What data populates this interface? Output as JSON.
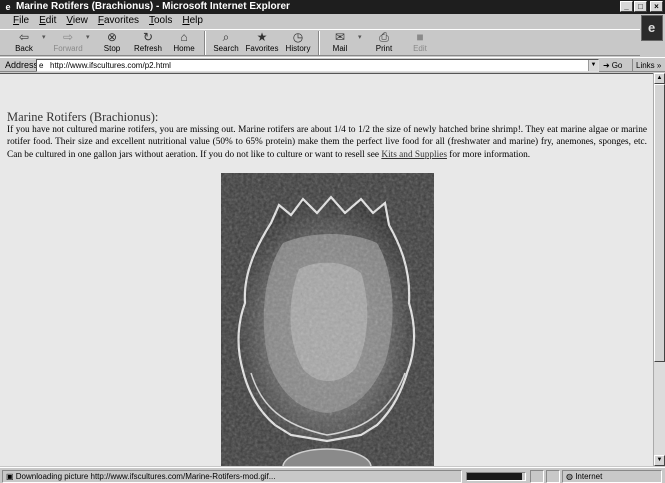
{
  "window": {
    "title": "Marine Rotifers (Brachionus) - Microsoft Internet Explorer",
    "minimize": "_",
    "maximize": "□",
    "close": "×"
  },
  "menu": [
    "File",
    "Edit",
    "View",
    "Favorites",
    "Tools",
    "Help"
  ],
  "toolbar": [
    {
      "label": "Back",
      "icon": "back-arrow-icon",
      "glyph": "⇦",
      "enabled": true
    },
    {
      "label": "Forward",
      "icon": "forward-arrow-icon",
      "glyph": "⇨",
      "enabled": false
    },
    {
      "label": "Stop",
      "icon": "stop-icon",
      "glyph": "⊗",
      "enabled": true
    },
    {
      "label": "Refresh",
      "icon": "refresh-icon",
      "glyph": "↻",
      "enabled": true
    },
    {
      "label": "Home",
      "icon": "home-icon",
      "glyph": "⌂",
      "enabled": true
    },
    {
      "label": "Search",
      "icon": "search-icon",
      "glyph": "⌕",
      "enabled": true
    },
    {
      "label": "Favorites",
      "icon": "favorites-icon",
      "glyph": "★",
      "enabled": true
    },
    {
      "label": "History",
      "icon": "history-icon",
      "glyph": "◷",
      "enabled": true
    },
    {
      "label": "Mail",
      "icon": "mail-icon",
      "glyph": "✉",
      "enabled": true
    },
    {
      "label": "Print",
      "icon": "print-icon",
      "glyph": "⎙",
      "enabled": true
    },
    {
      "label": "Edit",
      "icon": "edit-icon",
      "glyph": "■",
      "enabled": false
    }
  ],
  "address": {
    "label": "Address",
    "url": "http://www.ifscultures.com/p2.html",
    "go": "Go",
    "links": "Links"
  },
  "page": {
    "heading": "Marine Rotifers (Brachionus):",
    "body_text": "If you have not cultured marine rotifers, you are missing out. Marine rotifers are about 1/4 to 1/2 the size of newly hatched brine shrimp!. They eat marine algae or marine rotifer food. Their size and excellent nutritional value (50% to 65% protein) make them the perfect live food for all (freshwater and marine) fry, anemones, sponges, etc. Can be cultured in one gallon jars without aeration. If you do not like to culture or want to resell see ",
    "link_text": "Kits and Supplies",
    "body_end": " for more information."
  },
  "status": {
    "text": "Downloading picture http://www.ifscultures.com/Marine-Rotifers-mod.gif...",
    "progress": 0.95,
    "zone": "Internet"
  }
}
